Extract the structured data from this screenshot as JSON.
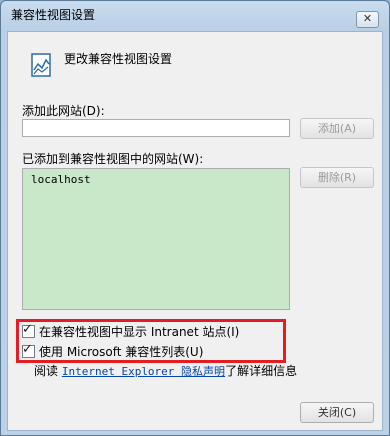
{
  "window": {
    "title": "兼容性视图设置",
    "close_glyph": "✕"
  },
  "header": {
    "text": "更改兼容性视图设置",
    "icon": "compatibility-view-icon"
  },
  "add_site": {
    "label": "添加此网站(D):",
    "input_value": "",
    "button_label": "添加(A)"
  },
  "added_sites": {
    "label": "已添加到兼容性视图中的网站(W):",
    "items": [
      "localhost"
    ],
    "remove_label": "删除(R)"
  },
  "options": {
    "intranet": {
      "label": "在兼容性视图中显示 Intranet 站点(I)",
      "checked": true
    },
    "microsoft_list": {
      "label": "使用 Microsoft 兼容性列表(U)",
      "checked": true
    }
  },
  "privacy": {
    "prefix": "阅读",
    "link": "Internet Explorer 隐私声明",
    "suffix": "了解详细信息"
  },
  "footer": {
    "close_label": "关闭(C)"
  },
  "colors": {
    "highlight": "#e41c23",
    "list_background": "#c9e7c9",
    "link": "#0645ad"
  }
}
